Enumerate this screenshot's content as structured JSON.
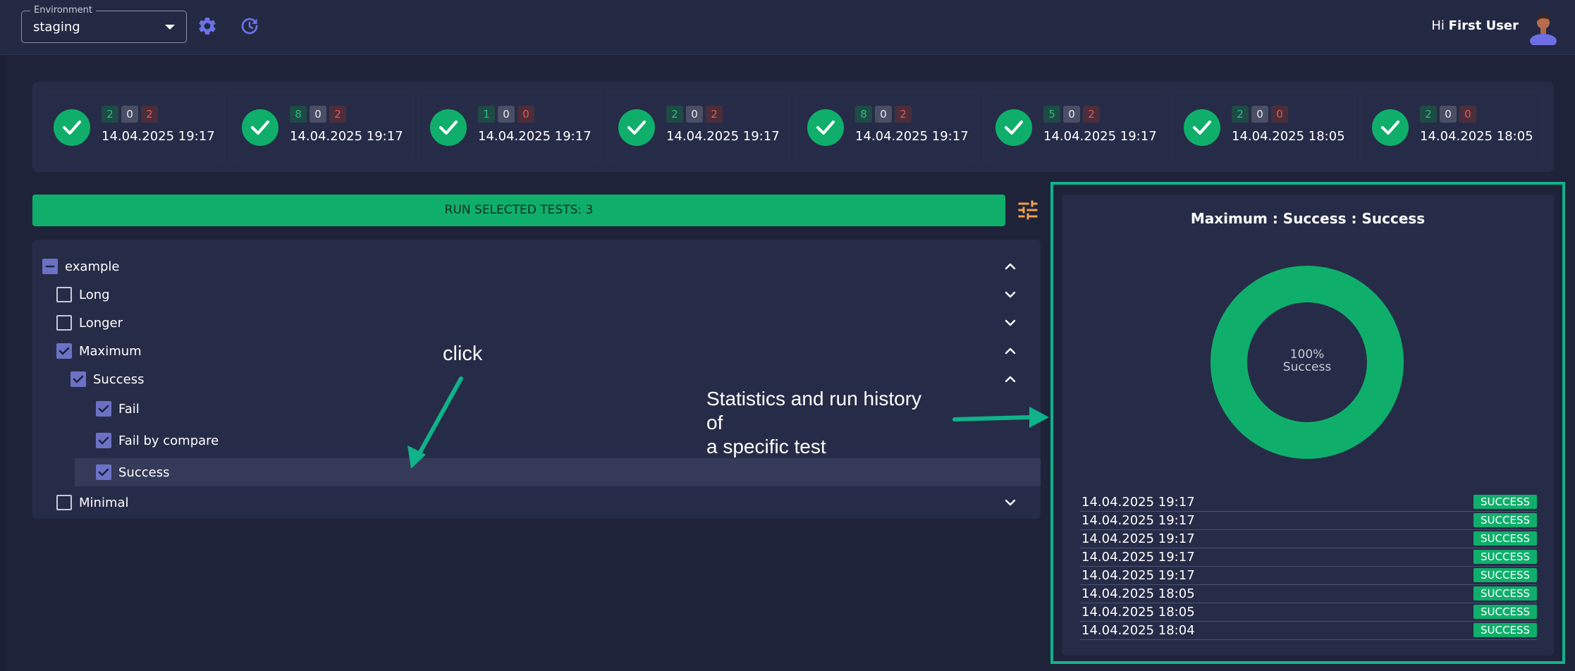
{
  "header": {
    "env_label": "Environment",
    "env_value": "staging",
    "greeting_prefix": "Hi ",
    "user_name": "First User"
  },
  "runs": [
    {
      "pass": "2",
      "skip": "0",
      "fail": "2",
      "date": "14.04.2025 19:17"
    },
    {
      "pass": "8",
      "skip": "0",
      "fail": "2",
      "date": "14.04.2025 19:17"
    },
    {
      "pass": "1",
      "skip": "0",
      "fail": "0",
      "date": "14.04.2025 19:17"
    },
    {
      "pass": "2",
      "skip": "0",
      "fail": "2",
      "date": "14.04.2025 19:17"
    },
    {
      "pass": "8",
      "skip": "0",
      "fail": "2",
      "date": "14.04.2025 19:17"
    },
    {
      "pass": "5",
      "skip": "0",
      "fail": "2",
      "date": "14.04.2025 19:17"
    },
    {
      "pass": "2",
      "skip": "0",
      "fail": "0",
      "date": "14.04.2025 18:05"
    },
    {
      "pass": "2",
      "skip": "0",
      "fail": "0",
      "date": "14.04.2025 18:05"
    }
  ],
  "run_button_label": "RUN SELECTED TESTS: 3",
  "tree": [
    {
      "label": "example",
      "state": "indeterminate",
      "chevron": "up"
    },
    {
      "label": "Long",
      "state": "empty",
      "chevron": "down"
    },
    {
      "label": "Longer",
      "state": "empty",
      "chevron": "down"
    },
    {
      "label": "Maximum",
      "state": "checked",
      "chevron": "up"
    },
    {
      "label": "Success",
      "state": "checked",
      "chevron": "up"
    },
    {
      "label": "Fail",
      "state": "checked",
      "chevron": ""
    },
    {
      "label": "Fail by compare",
      "state": "checked",
      "chevron": ""
    },
    {
      "label": "Success",
      "state": "checked",
      "chevron": "",
      "selected": true
    },
    {
      "label": "Minimal",
      "state": "empty",
      "chevron": "down"
    }
  ],
  "annotations": {
    "click": "click",
    "stats_line1": "Statistics and run history of",
    "stats_line2": "a specific test"
  },
  "stats": {
    "title": "Maximum : Success : Success",
    "percent": "100%",
    "center_label": "Success",
    "success_fraction": 1.0,
    "history": [
      {
        "date": "14.04.2025 19:17",
        "status": "SUCCESS"
      },
      {
        "date": "14.04.2025 19:17",
        "status": "SUCCESS"
      },
      {
        "date": "14.04.2025 19:17",
        "status": "SUCCESS"
      },
      {
        "date": "14.04.2025 19:17",
        "status": "SUCCESS"
      },
      {
        "date": "14.04.2025 19:17",
        "status": "SUCCESS"
      },
      {
        "date": "14.04.2025 18:05",
        "status": "SUCCESS"
      },
      {
        "date": "14.04.2025 18:05",
        "status": "SUCCESS"
      },
      {
        "date": "14.04.2025 18:04",
        "status": "SUCCESS"
      }
    ]
  },
  "colors": {
    "success_green": "#0faf6b",
    "accent_purple": "#6b72c6",
    "annotation_teal": "#0fb389",
    "filter_orange": "#f0a04b"
  },
  "icons": [
    "settings-icon",
    "refresh-icon",
    "avatar-icon",
    "check-icon",
    "filter-icon",
    "chevron-up-icon",
    "chevron-down-icon"
  ]
}
